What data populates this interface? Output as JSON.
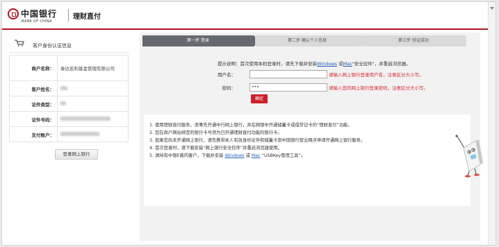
{
  "header": {
    "logo_cn": "中国银行",
    "logo_en": "BANK OF CHINA",
    "product_title": "理财直付"
  },
  "left_panel": {
    "title": "客户身份认证信息",
    "rows": [
      {
        "label": "商户名称：",
        "value": "泰达宏利基金管理有限公司"
      },
      {
        "label": "客户姓名：",
        "value": ""
      },
      {
        "label": "证件类型：",
        "value": ""
      },
      {
        "label": "证件号码：",
        "value": ""
      },
      {
        "label": "支付账户：",
        "value": ""
      }
    ],
    "login_button": "登录网上银行"
  },
  "steps": [
    {
      "label": "第一步  登录",
      "active": true
    },
    {
      "label": "第二步  确认个人信息",
      "active": false
    },
    {
      "label": "第三步  验证成功",
      "active": false
    }
  ],
  "tip": {
    "prefix": "提示说明：首次使用本机登录时，请先下载并安装",
    "link1": "Windows",
    "mid": " 或",
    "link2": "Mac",
    "suffix": "\"安全控件\"，并重启浏览器。"
  },
  "form": {
    "username_label": "用户名：",
    "username_value": "",
    "username_hint": "请输入网上银行登录用户名，注意区分大小写。",
    "password_label": "密码：",
    "password_value": "•••",
    "password_hint": "请输入您的网上银行登录密码，注意区分大小写。",
    "confirm_button": "确定"
  },
  "notes": {
    "items": [
      "1. 使用理财直付服务，须事先开通中行网上银行，并在网银中开通储蓄卡或借贷记卡的“理财直付”功能。",
      "2. 您在商户网站绑定的银行卡号须为已开通理财直付功能的银行卡。",
      "3. 如果您尚未开通网上银行，请先携带本人有效身份证件和储蓄卡到中国银行营业网点申请开通网上银行服务。",
      "4. 首次登录时，请下载安装“网上银行安全控件”并重启浏览器使用。"
    ],
    "item5_prefix": "5. 请持有中银E盾的客户，下载并安装 ",
    "item5_link1": "Windows",
    "item5_mid": " 或 ",
    "item5_link2": "Mac",
    "item5_suffix": " “USBKey管理工具”。"
  },
  "colors": {
    "brand_red": "#b3111c",
    "hint_red": "#d8262c",
    "link_blue": "#1c5fb8",
    "step_active": "#666a70"
  }
}
